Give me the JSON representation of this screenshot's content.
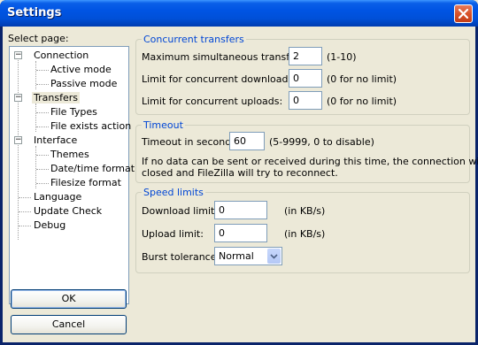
{
  "window": {
    "title": "Settings"
  },
  "sidebar": {
    "label": "Select page:",
    "items": [
      {
        "label": "Connection",
        "level": 0,
        "expander": "−"
      },
      {
        "label": "Active mode",
        "level": 1
      },
      {
        "label": "Passive mode",
        "level": 1
      },
      {
        "label": "Transfers",
        "level": 0,
        "expander": "−",
        "selected": true
      },
      {
        "label": "File Types",
        "level": 1
      },
      {
        "label": "File exists action",
        "level": 1
      },
      {
        "label": "Interface",
        "level": 0,
        "expander": "−"
      },
      {
        "label": "Themes",
        "level": 1
      },
      {
        "label": "Date/time format",
        "level": 1
      },
      {
        "label": "Filesize format",
        "level": 1
      },
      {
        "label": "Language",
        "level": 0
      },
      {
        "label": "Update Check",
        "level": 0
      },
      {
        "label": "Debug",
        "level": 0
      }
    ]
  },
  "buttons": {
    "ok": "OK",
    "cancel": "Cancel"
  },
  "concurrent": {
    "title": "Concurrent transfers",
    "max_label": "Maximum simultaneous transfers:",
    "max_value": "2",
    "max_hint": "(1-10)",
    "downloads_label": "Limit for concurrent downloads:",
    "downloads_value": "0",
    "downloads_hint": "(0 for no limit)",
    "uploads_label": "Limit for concurrent uploads:",
    "uploads_value": "0",
    "uploads_hint": "(0 for no limit)"
  },
  "timeout": {
    "title": "Timeout",
    "label": "Timeout in seconds:",
    "value": "60",
    "hint": "(5-9999, 0 to disable)",
    "description_line1": "If no data can be sent or received during this time, the connection will be",
    "description_line2": "closed and FileZilla will try to reconnect."
  },
  "speed": {
    "title": "Speed limits",
    "download_label": "Download limit:",
    "download_value": "0",
    "download_unit": "(in KB/s)",
    "upload_label": "Upload limit:",
    "upload_value": "0",
    "upload_unit": "(in KB/s)",
    "burst_label": "Burst tolerance:",
    "burst_value": "Normal"
  },
  "colors": {
    "titlebar": "#0054e3",
    "group_title": "#0046d5",
    "face": "#ece9d8",
    "close": "#d9532a"
  }
}
